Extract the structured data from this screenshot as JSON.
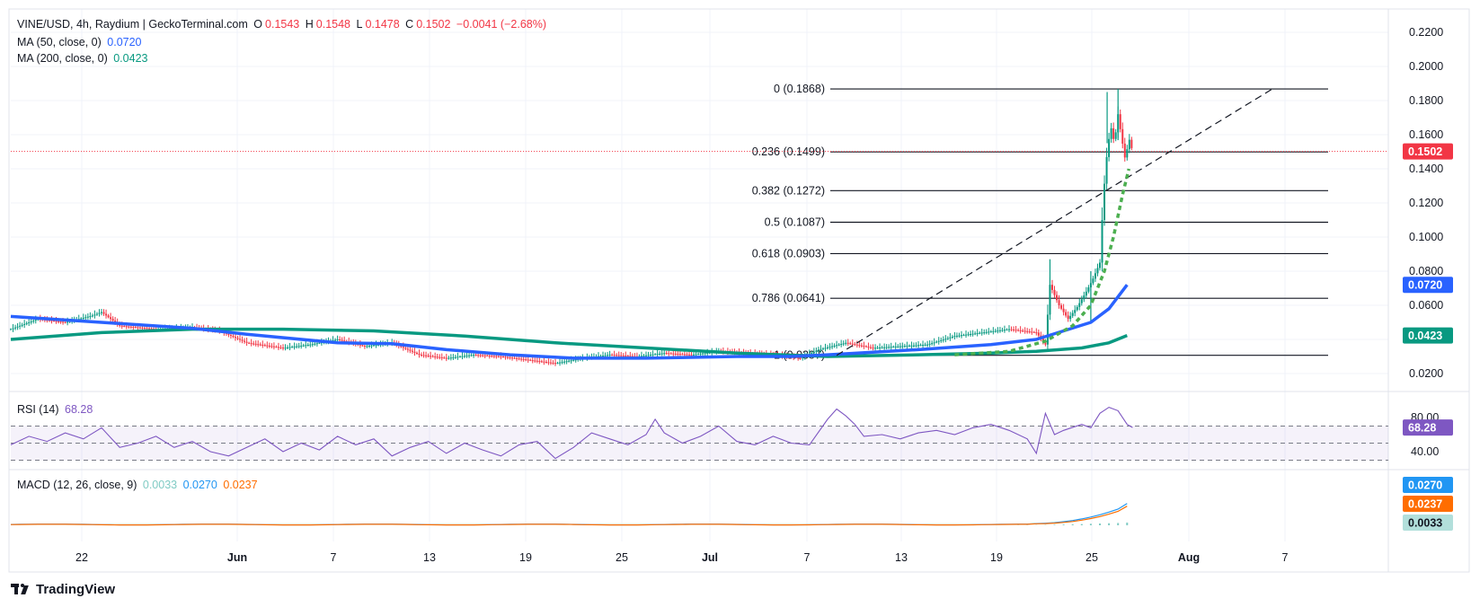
{
  "legend": {
    "symbol": "VINE/USD, 4h, Raydium | GeckoTerminal.com",
    "open_label": "O",
    "open": "0.1543",
    "high_label": "H",
    "high": "0.1548",
    "low_label": "L",
    "low": "0.1478",
    "close_label": "C",
    "close": "0.1502",
    "change": "−0.0041 (−2.68%)",
    "ma50_label": "MA (50, close, 0)",
    "ma50_value": "0.0720",
    "ma200_label": "MA (200, close, 0)",
    "ma200_value": "0.0423",
    "rsi_label": "RSI (14)",
    "rsi_value": "68.28",
    "macd_label": "MACD (12, 26, close, 9)",
    "macd_hist": "0.0033",
    "macd_line": "0.0270",
    "macd_signal": "0.0237"
  },
  "brand": "TradingView",
  "colors": {
    "up": "#089981",
    "down": "#f23645",
    "ma50": "#2962ff",
    "ma200": "#089981",
    "rsi": "#7e57c2",
    "macd": "#2196f3",
    "signal": "#ff6d00",
    "hist": "#80cbc4",
    "fib": "#131722",
    "grid": "#f0f3fa",
    "trend_curve": "#4caf50"
  },
  "chart_data": {
    "type": "candlestick",
    "price_axis": {
      "ticks": [
        "0.2200",
        "0.2000",
        "0.1800",
        "0.1600",
        "0.1400",
        "0.1200",
        "0.1000",
        "0.0800",
        "0.0600",
        "0.0400",
        "0.0200"
      ],
      "ylim": [
        0.01,
        0.23
      ],
      "current_price": "0.1502",
      "ma50_tag": "0.0720",
      "ma200_tag": "0.0423"
    },
    "time_axis": {
      "ticks": [
        "22",
        "Jun",
        "7",
        "13",
        "19",
        "25",
        "Jul",
        "7",
        "13",
        "19",
        "25",
        "Aug",
        "7"
      ]
    },
    "fibonacci": [
      {
        "label": "0 (0.1868)",
        "value": 0.1868
      },
      {
        "label": "0.236 (0.1499)",
        "value": 0.1499
      },
      {
        "label": "0.382 (0.1272)",
        "value": 0.1272
      },
      {
        "label": "0.5 (0.1087)",
        "value": 0.1087
      },
      {
        "label": "0.618 (0.0903)",
        "value": 0.0903
      },
      {
        "label": "0.786 (0.0641)",
        "value": 0.0641
      },
      {
        "label": "1 (0.0307)",
        "value": 0.0307
      }
    ],
    "price_path": [
      [
        0,
        0.046
      ],
      [
        3,
        0.052
      ],
      [
        6,
        0.05
      ],
      [
        9,
        0.054
      ],
      [
        10,
        0.056
      ],
      [
        12,
        0.048
      ],
      [
        16,
        0.046
      ],
      [
        20,
        0.047
      ],
      [
        23,
        0.045
      ],
      [
        26,
        0.038
      ],
      [
        30,
        0.035
      ],
      [
        33,
        0.037
      ],
      [
        36,
        0.04
      ],
      [
        39,
        0.036
      ],
      [
        42,
        0.038
      ],
      [
        45,
        0.031
      ],
      [
        48,
        0.029
      ],
      [
        51,
        0.031
      ],
      [
        54,
        0.03
      ],
      [
        57,
        0.028
      ],
      [
        60,
        0.026
      ],
      [
        63,
        0.029
      ],
      [
        66,
        0.031
      ],
      [
        69,
        0.03
      ],
      [
        72,
        0.032
      ],
      [
        75,
        0.031
      ],
      [
        78,
        0.033
      ],
      [
        81,
        0.032
      ],
      [
        84,
        0.031
      ],
      [
        87,
        0.029
      ],
      [
        89,
        0.034
      ],
      [
        92,
        0.038
      ],
      [
        95,
        0.035
      ],
      [
        98,
        0.036
      ],
      [
        101,
        0.037
      ],
      [
        104,
        0.042
      ],
      [
        107,
        0.044
      ],
      [
        110,
        0.046
      ],
      [
        113,
        0.044
      ],
      [
        114,
        0.037
      ],
      [
        114.5,
        0.072
      ],
      [
        115.5,
        0.06
      ],
      [
        116.5,
        0.052
      ],
      [
        117.5,
        0.059
      ],
      [
        118.5,
        0.068
      ],
      [
        119.2,
        0.075
      ],
      [
        120,
        0.085
      ],
      [
        120.4,
        0.125
      ],
      [
        120.8,
        0.15
      ],
      [
        121.2,
        0.165
      ],
      [
        121.6,
        0.155
      ],
      [
        122,
        0.172
      ],
      [
        122.4,
        0.158
      ],
      [
        122.8,
        0.145
      ],
      [
        123.2,
        0.158
      ],
      [
        123.6,
        0.1502
      ]
    ],
    "ma50_path": [
      [
        0,
        0.0535
      ],
      [
        10,
        0.05
      ],
      [
        20,
        0.0465
      ],
      [
        26,
        0.043
      ],
      [
        36,
        0.038
      ],
      [
        42,
        0.0375
      ],
      [
        48,
        0.034
      ],
      [
        55,
        0.031
      ],
      [
        62,
        0.029
      ],
      [
        70,
        0.029
      ],
      [
        80,
        0.03
      ],
      [
        86,
        0.03
      ],
      [
        90,
        0.031
      ],
      [
        100,
        0.034
      ],
      [
        108,
        0.037
      ],
      [
        113,
        0.04
      ],
      [
        116,
        0.045
      ],
      [
        119,
        0.05
      ],
      [
        121,
        0.058
      ],
      [
        123,
        0.072
      ]
    ],
    "ma200_path": [
      [
        0,
        0.04
      ],
      [
        10,
        0.044
      ],
      [
        20,
        0.046
      ],
      [
        30,
        0.046
      ],
      [
        40,
        0.045
      ],
      [
        50,
        0.042
      ],
      [
        60,
        0.038
      ],
      [
        70,
        0.035
      ],
      [
        80,
        0.032
      ],
      [
        90,
        0.03
      ],
      [
        100,
        0.031
      ],
      [
        108,
        0.032
      ],
      [
        113,
        0.033
      ],
      [
        118,
        0.035
      ],
      [
        121,
        0.038
      ],
      [
        123,
        0.0423
      ]
    ],
    "trend_line": [
      [
        91,
        0.0307
      ],
      [
        139,
        0.1868
      ]
    ],
    "parabolic_curve": [
      [
        104,
        0.031
      ],
      [
        110,
        0.033
      ],
      [
        114,
        0.039
      ],
      [
        117,
        0.048
      ],
      [
        119,
        0.06
      ],
      [
        120.5,
        0.08
      ],
      [
        121.5,
        0.1
      ],
      [
        122.5,
        0.125
      ],
      [
        123.2,
        0.14
      ]
    ],
    "rsi": {
      "ylim": [
        20,
        100
      ],
      "ticks": [
        "80.00",
        "40.00"
      ],
      "overbought": 70,
      "middle": 50,
      "oversold": 30,
      "current": "68.28",
      "path": [
        [
          0,
          48
        ],
        [
          2,
          58
        ],
        [
          4,
          52
        ],
        [
          6,
          62
        ],
        [
          8,
          55
        ],
        [
          10,
          68
        ],
        [
          12,
          45
        ],
        [
          14,
          50
        ],
        [
          16,
          58
        ],
        [
          18,
          45
        ],
        [
          20,
          52
        ],
        [
          22,
          40
        ],
        [
          24,
          35
        ],
        [
          26,
          45
        ],
        [
          28,
          55
        ],
        [
          30,
          40
        ],
        [
          32,
          50
        ],
        [
          34,
          42
        ],
        [
          36,
          58
        ],
        [
          38,
          48
        ],
        [
          40,
          55
        ],
        [
          42,
          35
        ],
        [
          44,
          45
        ],
        [
          46,
          52
        ],
        [
          48,
          38
        ],
        [
          50,
          50
        ],
        [
          52,
          42
        ],
        [
          54,
          35
        ],
        [
          56,
          48
        ],
        [
          58,
          52
        ],
        [
          60,
          32
        ],
        [
          62,
          45
        ],
        [
          64,
          62
        ],
        [
          66,
          55
        ],
        [
          68,
          48
        ],
        [
          70,
          60
        ],
        [
          71,
          78
        ],
        [
          72,
          62
        ],
        [
          74,
          50
        ],
        [
          76,
          58
        ],
        [
          78,
          70
        ],
        [
          80,
          52
        ],
        [
          82,
          48
        ],
        [
          84,
          58
        ],
        [
          86,
          50
        ],
        [
          88,
          48
        ],
        [
          90,
          78
        ],
        [
          91,
          90
        ],
        [
          92,
          82
        ],
        [
          93,
          72
        ],
        [
          94,
          58
        ],
        [
          96,
          60
        ],
        [
          98,
          55
        ],
        [
          100,
          62
        ],
        [
          102,
          65
        ],
        [
          104,
          60
        ],
        [
          106,
          68
        ],
        [
          108,
          72
        ],
        [
          110,
          65
        ],
        [
          112,
          55
        ],
        [
          113,
          38
        ],
        [
          114,
          85
        ],
        [
          115,
          60
        ],
        [
          116,
          65
        ],
        [
          118,
          72
        ],
        [
          119,
          68
        ],
        [
          120,
          85
        ],
        [
          121,
          92
        ],
        [
          122,
          88
        ],
        [
          123,
          72
        ],
        [
          123.6,
          68.28
        ]
      ]
    },
    "macd": {
      "current_macd": "0.0270",
      "current_signal": "0.0237",
      "current_hist": "0.0033"
    }
  }
}
